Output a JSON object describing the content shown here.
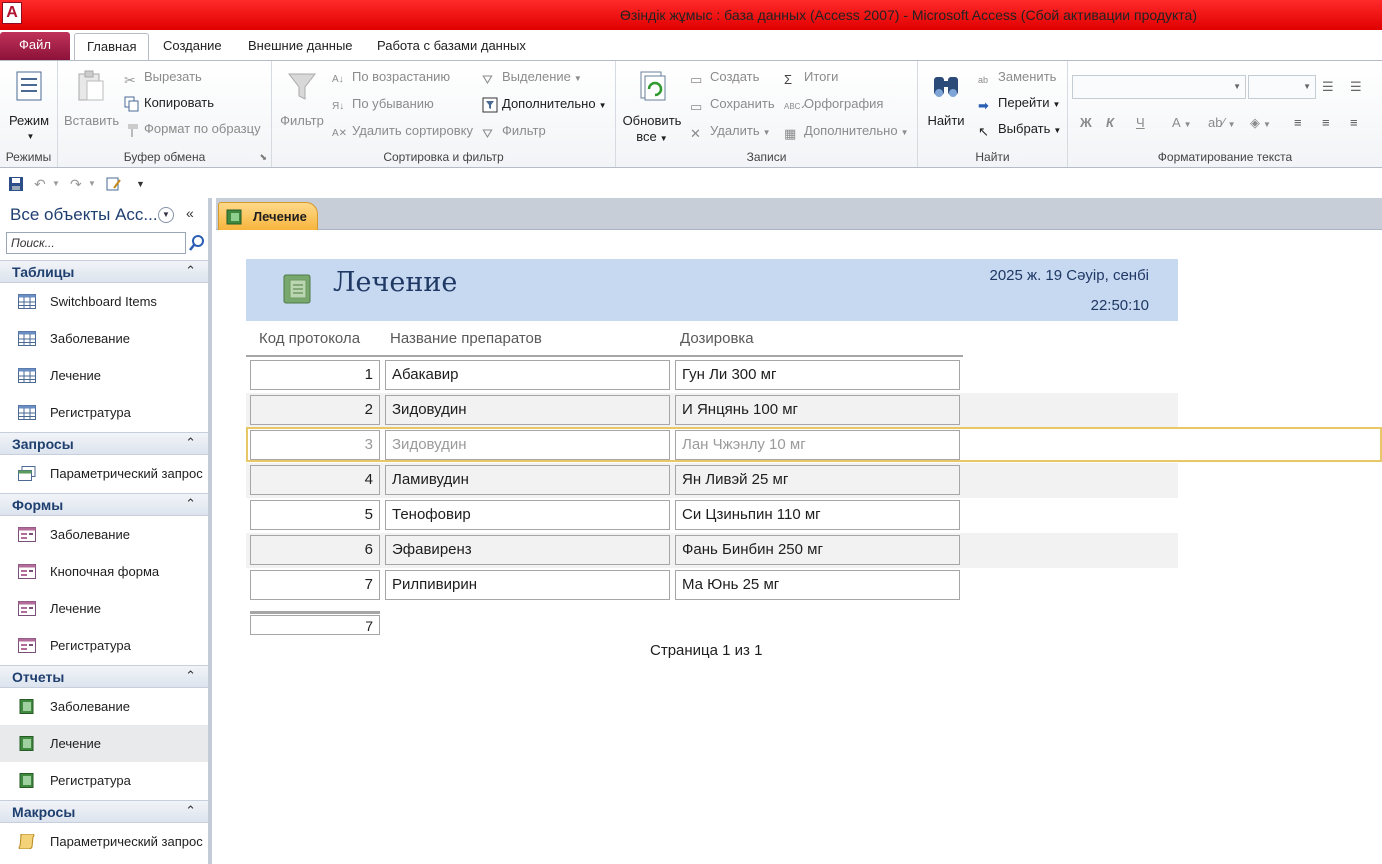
{
  "window": {
    "title": "Өзіндік жұмыс : база данных (Access 2007)  -  Microsoft Access (Сбой активации продукта)",
    "app_icon_letter": "A"
  },
  "ribbon_tabs": [
    "Файл",
    "Главная",
    "Создание",
    "Внешние данные",
    "Работа с базами данных"
  ],
  "ribbon": {
    "views": {
      "mode": "Режим",
      "label": "Режимы"
    },
    "clipboard": {
      "paste": "Вставить",
      "cut": "Вырезать",
      "copy": "Копировать",
      "format_painter": "Формат по образцу",
      "label": "Буфер обмена"
    },
    "sort_filter": {
      "filter": "Фильтр",
      "asc": "По возрастанию",
      "desc": "По убыванию",
      "remove_sort": "Удалить сортировку",
      "selection": "Выделение",
      "advanced": "Дополнительно",
      "toggle_filter": "Фильтр",
      "label": "Сортировка и фильтр"
    },
    "records": {
      "refresh_line1": "Обновить",
      "refresh_line2": "все",
      "new": "Создать",
      "save": "Сохранить",
      "delete": "Удалить",
      "totals": "Итоги",
      "spelling": "Орфография",
      "more": "Дополнительно",
      "label": "Записи"
    },
    "find": {
      "find": "Найти",
      "replace": "Заменить",
      "goto": "Перейти",
      "select": "Выбрать",
      "label": "Найти"
    },
    "text_formatting": {
      "label": "Форматирование текста",
      "bold": "Ж",
      "italic": "К",
      "underline": "Ч",
      "font_color_letter": "A"
    }
  },
  "nav": {
    "title": "Все объекты Acc...",
    "search_placeholder": "Поиск...",
    "groups": [
      {
        "title": "Таблицы",
        "items": [
          "Switchboard Items",
          "Заболевание",
          "Лечение",
          "Регистратура"
        ]
      },
      {
        "title": "Запросы",
        "items": [
          "Параметрический запрос"
        ]
      },
      {
        "title": "Формы",
        "items": [
          "Заболевание",
          "Кнопочная форма",
          "Лечение",
          "Регистратура"
        ]
      },
      {
        "title": "Отчеты",
        "items": [
          "Заболевание",
          "Лечение",
          "Регистратура"
        ]
      },
      {
        "title": "Макросы",
        "items": [
          "Параметрический запрос"
        ]
      }
    ],
    "collapse_glyph": "«",
    "group_collapse_glyph": "⌃"
  },
  "doc_tab": {
    "label": "Лечение"
  },
  "report": {
    "title": "Лечение",
    "date": "2025 ж. 19 Сәуір, сенбі",
    "time": "22:50:10",
    "columns": [
      "Код протокола",
      "Название препаратов",
      "Дозировка"
    ],
    "rows": [
      [
        "1",
        "Абакавир",
        "Гун Ли 300 мг"
      ],
      [
        "2",
        "Зидовудин",
        "И Янцянь 100 мг"
      ],
      [
        "3",
        "Зидовудин",
        "Лан Чжэнлу 10 мг"
      ],
      [
        "4",
        "Ламивудин",
        "Ян Ливэй 25 мг"
      ],
      [
        "5",
        "Тенофовир",
        "Си Цзиньпин  110 мг"
      ],
      [
        "6",
        "Эфавиренз",
        "Фань Бинбин 250 мг"
      ],
      [
        "7",
        "Рилпивирин",
        "Ма Юнь 25 мг"
      ]
    ],
    "total_count": "7",
    "pager": "Страница 1 из 1"
  }
}
